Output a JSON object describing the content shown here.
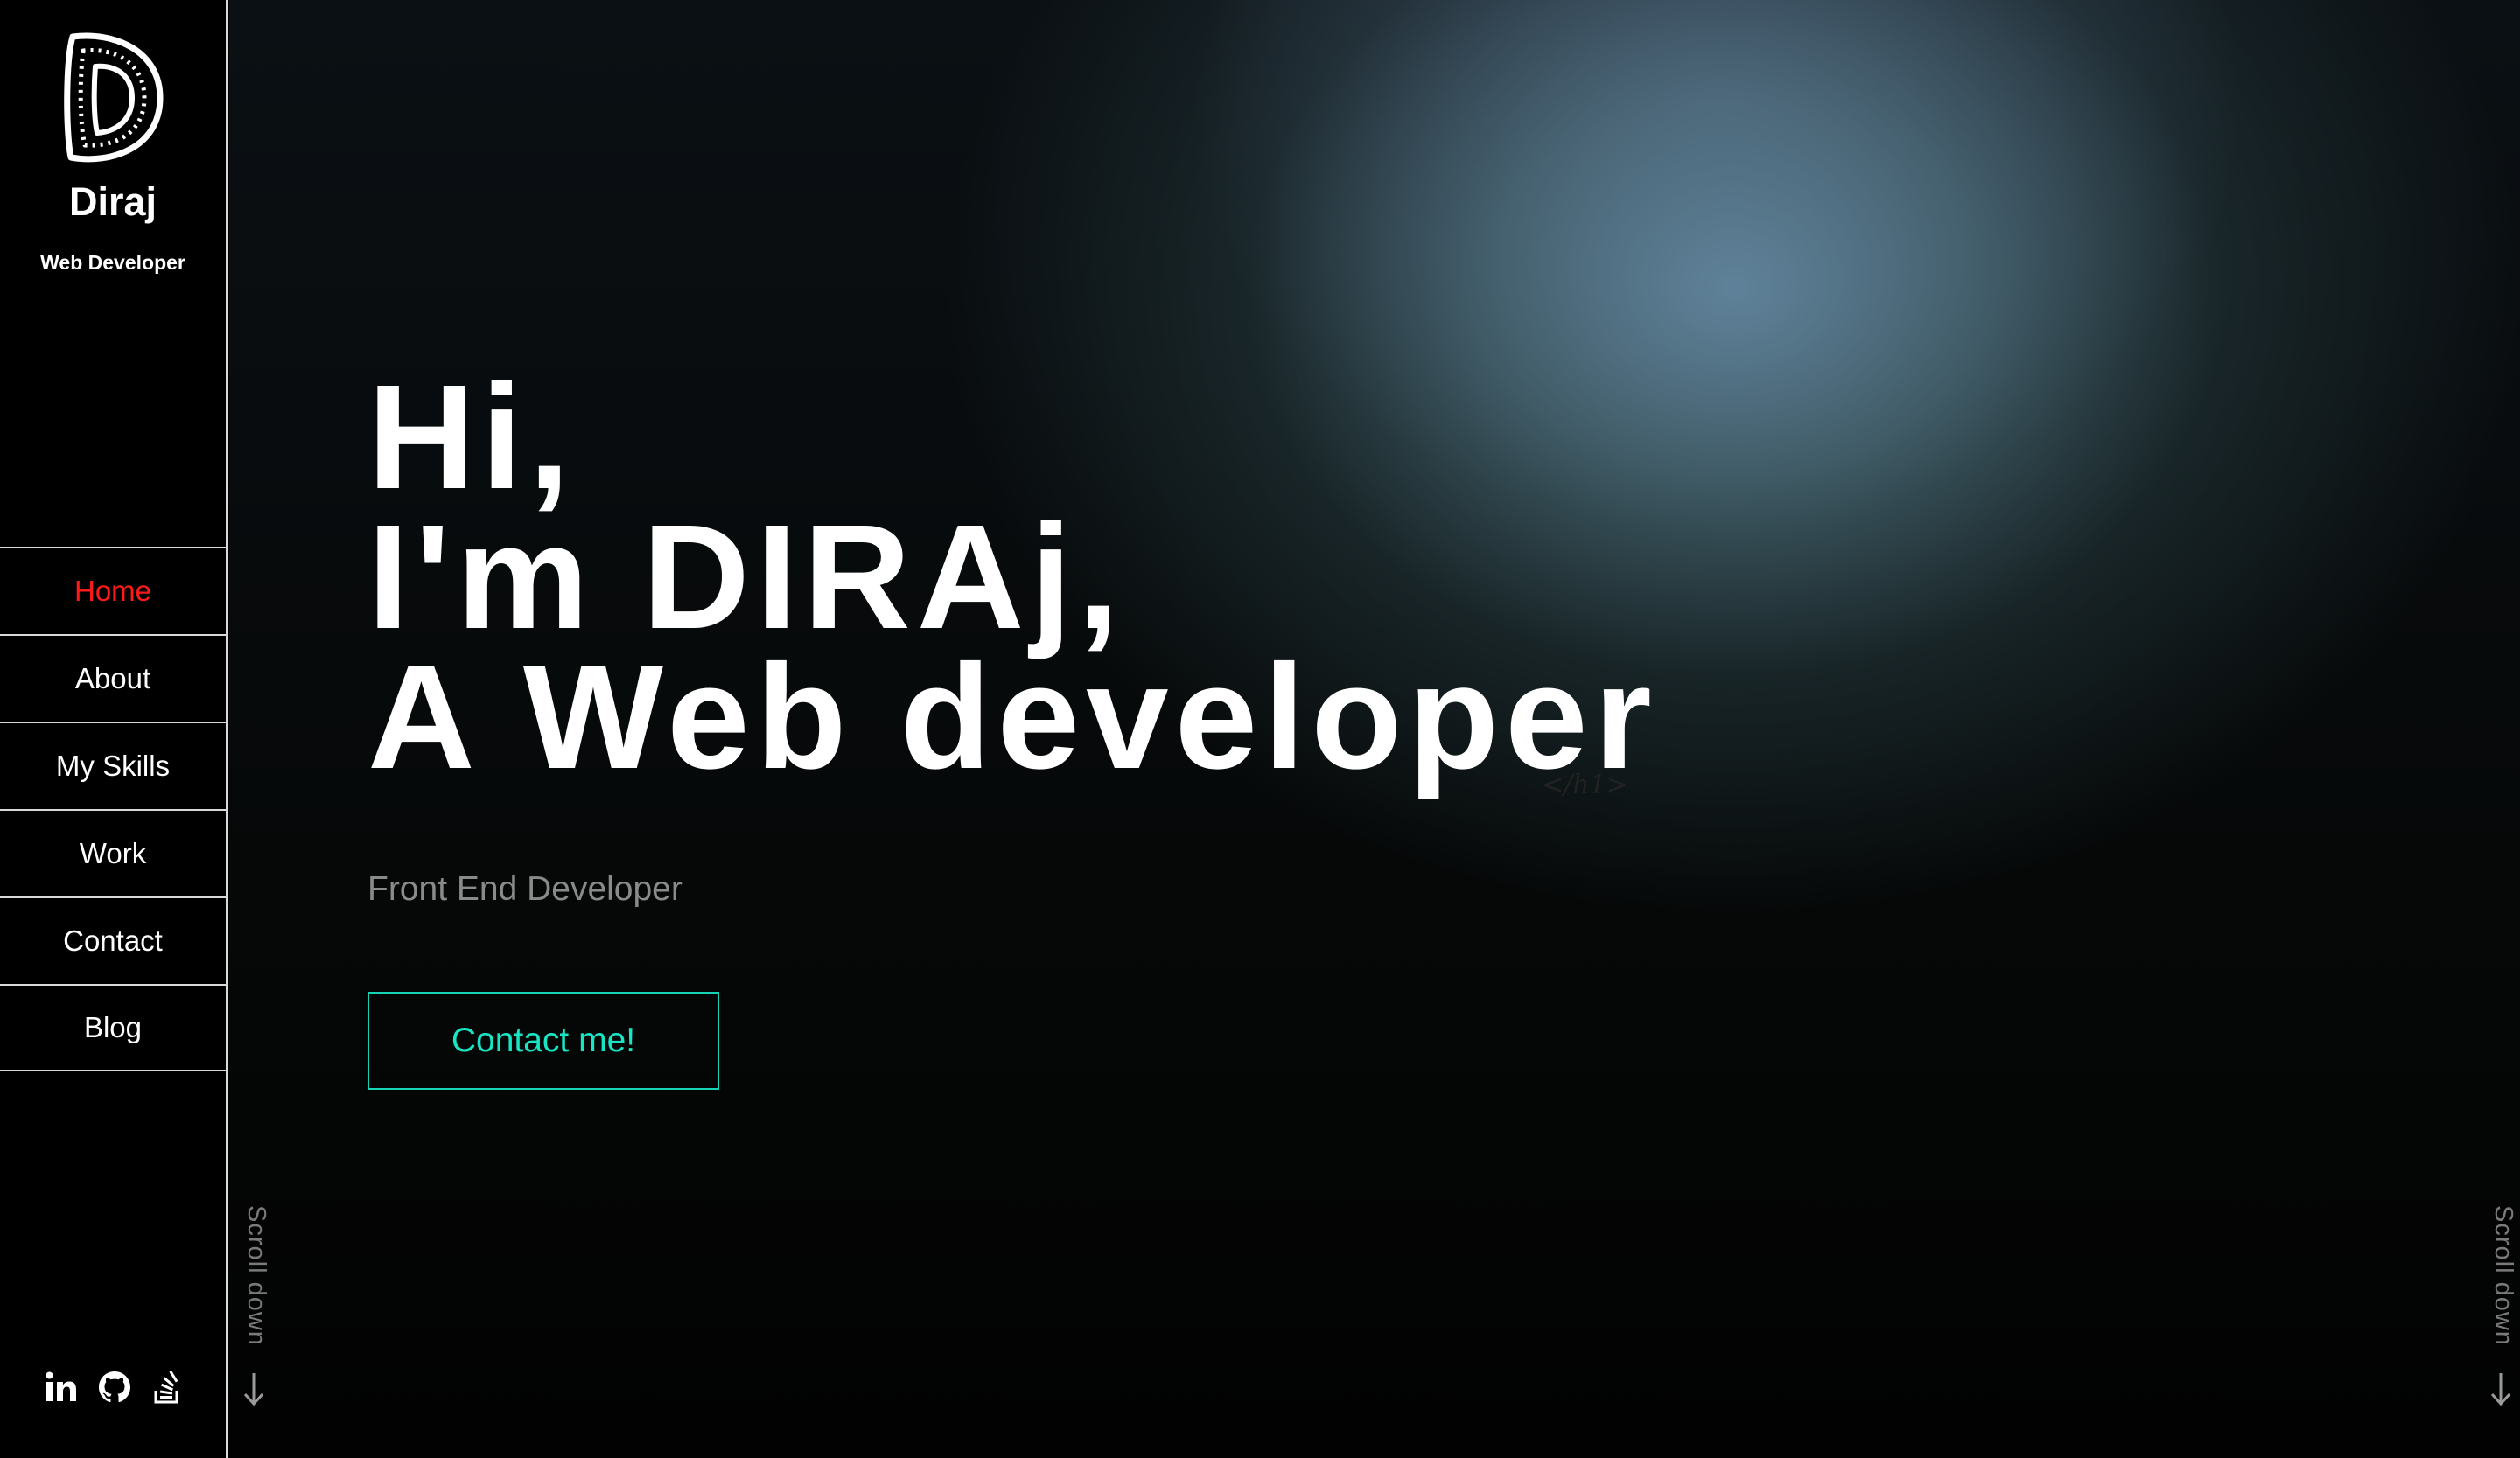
{
  "brand": {
    "name": "Diraj",
    "role": "Web Developer",
    "logo_icon": "letter-d-logo-icon"
  },
  "nav": {
    "items": [
      {
        "label": "Home",
        "active": true
      },
      {
        "label": "About",
        "active": false
      },
      {
        "label": "My Skills",
        "active": false
      },
      {
        "label": "Work",
        "active": false
      },
      {
        "label": "Contact",
        "active": false
      },
      {
        "label": "Blog",
        "active": false
      }
    ]
  },
  "socials": [
    {
      "icon": "linkedin-icon"
    },
    {
      "icon": "github-icon"
    },
    {
      "icon": "stack-overflow-icon"
    }
  ],
  "hero": {
    "line1": "Hi,",
    "line2": "I'm DIRAj,",
    "line3": "A Web developer",
    "closing_tag": "</h1>",
    "subtitle": "Front End Developer",
    "cta_label": "Contact me!"
  },
  "scroll": {
    "left_label": "Scroll down",
    "right_label": "Scroll down",
    "arrow_icon": "arrow-down-icon"
  },
  "colors": {
    "active_nav": "#ff1a1a",
    "cta_accent": "#18e5c4",
    "subtitle": "#8a8a8a",
    "divider": "#d9d9d9"
  }
}
